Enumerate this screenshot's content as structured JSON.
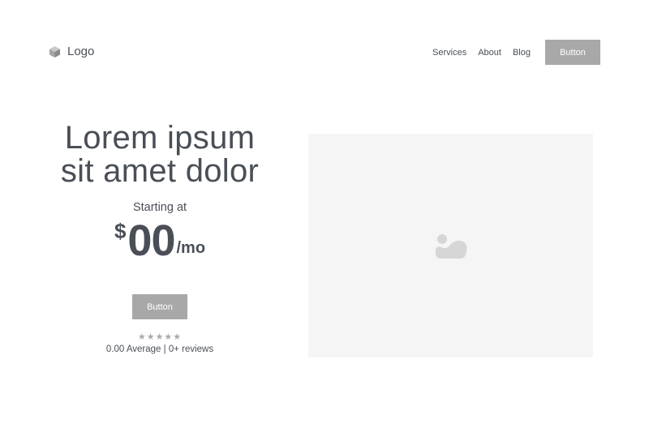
{
  "header": {
    "logo_text": "Logo",
    "logo_icon": "cube-icon",
    "nav": [
      {
        "label": "Services"
      },
      {
        "label": "About"
      },
      {
        "label": "Blog"
      }
    ],
    "button_label": "Button"
  },
  "hero": {
    "title_line1": "Lorem ipsum",
    "title_line2": "sit amet dolor",
    "starting_at": "Starting at",
    "price_currency": "$",
    "price_amount": "00",
    "price_period": "/mo",
    "button_label": "Button",
    "stars": "★★★★★",
    "rating_text": "0.00 Average | 0+ reviews"
  },
  "media": {
    "icon": "image-icon"
  },
  "colors": {
    "text": "#4a4f57",
    "button_bg": "#a8a8a8",
    "placeholder_bg": "#f5f5f5",
    "placeholder_icon": "#d6d6d6"
  }
}
